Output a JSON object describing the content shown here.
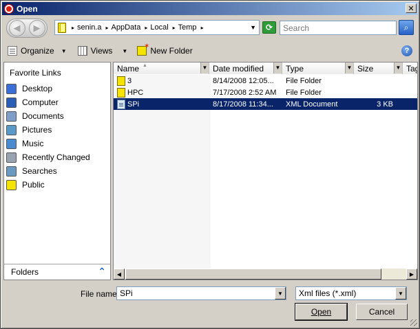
{
  "window": {
    "title": "Open"
  },
  "nav": {
    "back_glyph": "◀",
    "forward_glyph": "▶",
    "breadcrumbs": [
      "senin.a",
      "AppData",
      "Local",
      "Temp"
    ],
    "search_placeholder": "Search"
  },
  "toolbar": {
    "organize": "Organize",
    "views": "Views",
    "new_folder": "New Folder",
    "help": "?"
  },
  "sidebar": {
    "header": "Favorite Links",
    "items": [
      {
        "label": "Desktop",
        "icon": "desktop-icon",
        "color": "#3a6fd8"
      },
      {
        "label": "Computer",
        "icon": "computer-icon",
        "color": "#2a5fb8"
      },
      {
        "label": "Documents",
        "icon": "documents-icon",
        "color": "#7f9fc8"
      },
      {
        "label": "Pictures",
        "icon": "pictures-icon",
        "color": "#5a9ac8"
      },
      {
        "label": "Music",
        "icon": "music-icon",
        "color": "#4a8ad0"
      },
      {
        "label": "Recently Changed",
        "icon": "recent-icon",
        "color": "#9aa4b0"
      },
      {
        "label": "Searches",
        "icon": "searches-icon",
        "color": "#6a9ac0"
      },
      {
        "label": "Public",
        "icon": "public-folder-icon",
        "color": "#f5e300"
      }
    ],
    "folders_label": "Folders"
  },
  "columns": [
    "Name",
    "Date modified",
    "Type",
    "Size",
    "Tags"
  ],
  "files": [
    {
      "name": "3",
      "date": "8/14/2008 12:05...",
      "type": "File Folder",
      "size": "",
      "kind": "folder"
    },
    {
      "name": "HPC",
      "date": "7/17/2008 2:52 AM",
      "type": "File Folder",
      "size": "",
      "kind": "folder"
    },
    {
      "name": "SPi",
      "date": "8/17/2008 11:34...",
      "type": "XML Document",
      "size": "3 KB",
      "kind": "xml",
      "selected": true
    }
  ],
  "bottom": {
    "filename_label": "File name:",
    "filename_value": "SPi",
    "filetype_value": "Xml files (*.xml)",
    "open_label": "Open",
    "cancel_label": "Cancel"
  }
}
